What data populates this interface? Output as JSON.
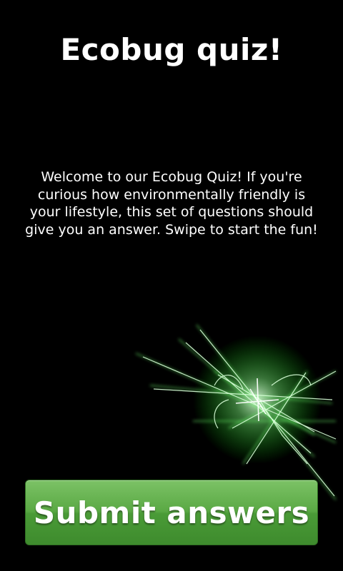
{
  "screen": {
    "title": "Ecobug quiz!",
    "intro": "Welcome to our Ecobug Quiz! If you're curious how environmentally friendly is your lifestyle, this set of questions should give you an answer. Swipe to start the fun!"
  },
  "decoration": {
    "icon": "green-light-streaks",
    "color": "#7dff7d"
  },
  "submit": {
    "label": "Submit answers",
    "color": "#5aa944"
  }
}
